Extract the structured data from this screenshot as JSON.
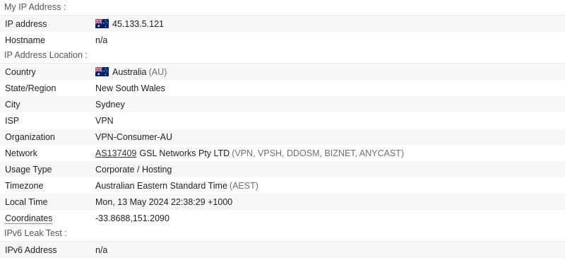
{
  "sections": {
    "my_ip": {
      "title": "My IP Address :",
      "rows": {
        "ip_address": {
          "label": "IP address",
          "value": "45.133.5.121",
          "flag": "australia-flag-icon"
        },
        "hostname": {
          "label": "Hostname",
          "value": "n/a"
        }
      }
    },
    "location": {
      "title": "IP Address Location :",
      "rows": {
        "country": {
          "label": "Country",
          "value": "Australia",
          "extra": "(AU)",
          "flag": "australia-flag-icon"
        },
        "state": {
          "label": "State/Region",
          "value": "New South Wales"
        },
        "city": {
          "label": "City",
          "value": "Sydney"
        },
        "isp": {
          "label": "ISP",
          "value": "VPN"
        },
        "organization": {
          "label": "Organization",
          "value": "VPN-Consumer-AU"
        },
        "network": {
          "label": "Network",
          "asn": "AS137409",
          "value": "GSL Networks Pty LTD",
          "extra": "(VPN, VPSH, DDOSM, BIZNET, ANYCAST)"
        },
        "usage_type": {
          "label": "Usage Type",
          "value": "Corporate / Hosting"
        },
        "timezone": {
          "label": "Timezone",
          "value": "Australian Eastern Standard Time",
          "extra": "(AEST)"
        },
        "local_time": {
          "label": "Local Time",
          "value": "Mon, 13 May 2024 22:38:29 +1000"
        },
        "coordinates": {
          "label": "Coordinates",
          "value": "-33.8688,151.2090"
        }
      }
    },
    "ipv6": {
      "title": "IPv6 Leak Test :",
      "rows": {
        "ipv6_address": {
          "label": "IPv6 Address",
          "value": "n/a"
        }
      }
    }
  },
  "colors": {
    "row_alt_bg": "#f7f7f7",
    "header_text": "#555555",
    "muted_text": "#6f6f6f",
    "flag_blue": "#012169",
    "flag_red": "#C8102E"
  }
}
